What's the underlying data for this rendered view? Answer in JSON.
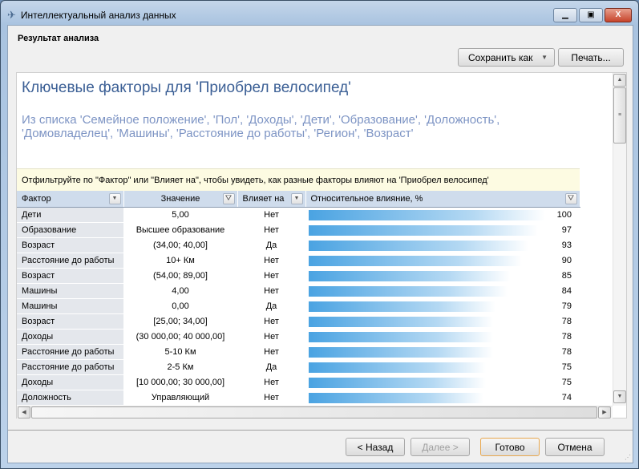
{
  "window": {
    "title": "Интеллектуальный анализ данных",
    "icon": "mining-wizard-icon"
  },
  "header": "Результат анализа",
  "toolbar": {
    "save_as": "Сохранить как",
    "print": "Печать..."
  },
  "report": {
    "title": "Ключевые факторы для 'Приобрел велосипед'",
    "subtitle": "Из списка 'Семейное положение', 'Пол', 'Доходы', 'Дети', 'Образование', 'Доложность', 'Домовладелец', 'Машины', 'Расстояние до работы', 'Регион', 'Возраст'",
    "hint": "Отфильтруйте по \"Фактор\" или \"Влияет на\", чтобы увидеть, как разные факторы влияют на 'Приобрел велосипед'",
    "columns": [
      "Фактор",
      "Значение",
      "Влияет на",
      "Относительное влияние, %"
    ],
    "rows": [
      {
        "factor": "Дети",
        "value": "5,00",
        "impacts": "Нет",
        "score": 100
      },
      {
        "factor": "Образование",
        "value": "Высшее образование",
        "impacts": "Нет",
        "score": 97
      },
      {
        "factor": "Возраст",
        "value": "(34,00; 40,00]",
        "impacts": "Да",
        "score": 93
      },
      {
        "factor": "Расстояние до работы",
        "value": "10+ Км",
        "impacts": "Нет",
        "score": 90
      },
      {
        "factor": "Возраст",
        "value": "(54,00; 89,00]",
        "impacts": "Нет",
        "score": 85
      },
      {
        "factor": "Машины",
        "value": "4,00",
        "impacts": "Нет",
        "score": 84
      },
      {
        "factor": "Машины",
        "value": "0,00",
        "impacts": "Да",
        "score": 79
      },
      {
        "factor": "Возраст",
        "value": "[25,00; 34,00]",
        "impacts": "Нет",
        "score": 78
      },
      {
        "factor": "Доходы",
        "value": "(30 000,00; 40 000,00]",
        "impacts": "Нет",
        "score": 78
      },
      {
        "factor": "Расстояние до работы",
        "value": "5-10 Км",
        "impacts": "Нет",
        "score": 78
      },
      {
        "factor": "Расстояние до работы",
        "value": "2-5 Км",
        "impacts": "Да",
        "score": 75
      },
      {
        "factor": "Доходы",
        "value": "[10 000,00; 30 000,00]",
        "impacts": "Нет",
        "score": 75
      },
      {
        "factor": "Доложность",
        "value": "Управляющий",
        "impacts": "Нет",
        "score": 74
      }
    ]
  },
  "footer": {
    "back": "< Назад",
    "next": "Далее >",
    "finish": "Готово",
    "cancel": "Отмена"
  },
  "colors": {
    "bar": "#4aa3e2",
    "title": "#3b5f95",
    "subtitle": "#7d94c4"
  }
}
